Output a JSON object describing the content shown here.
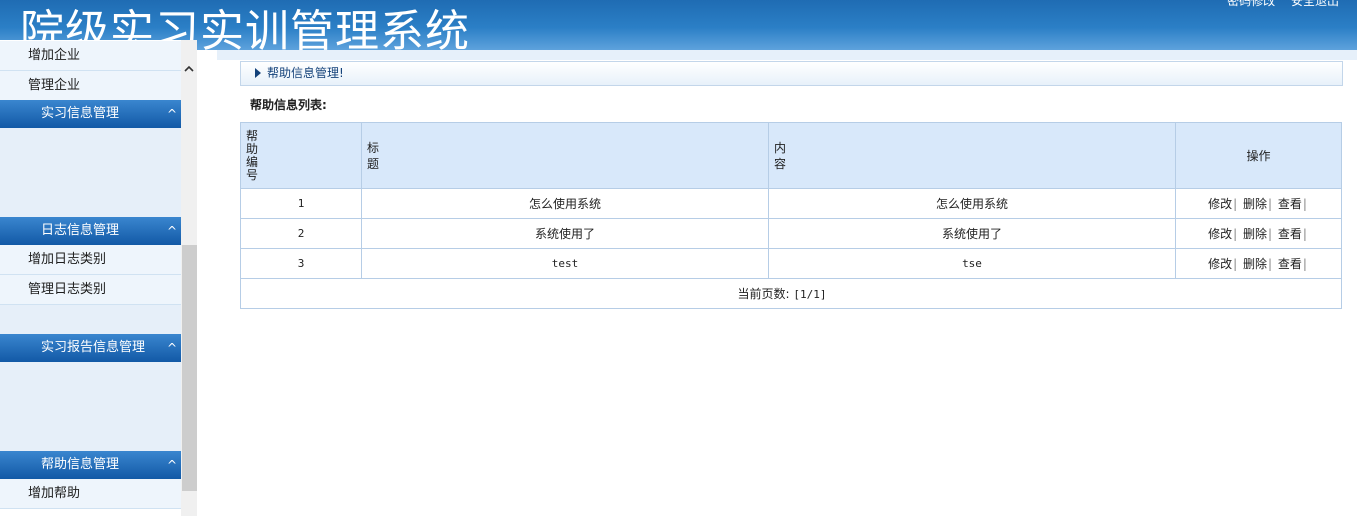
{
  "header": {
    "title": "院级实习实训管理系统",
    "links": [
      "密码修改",
      "安全退出"
    ]
  },
  "sidebar": {
    "top_items": [
      "增加企业",
      "管理企业"
    ],
    "groups": [
      {
        "label": "实习信息管理",
        "items": []
      },
      {
        "label": "日志信息管理",
        "items": [
          "增加日志类别",
          "管理日志类别"
        ]
      },
      {
        "label": "实习报告信息管理",
        "items": []
      },
      {
        "label": "帮助信息管理",
        "items": [
          "增加帮助"
        ]
      }
    ],
    "chevron": "^"
  },
  "main": {
    "breadcrumb": "帮助信息管理!",
    "list_title": "帮助信息列表:",
    "table": {
      "headers": [
        "帮助编号",
        "标题",
        "内容",
        "操作"
      ],
      "rows": [
        {
          "id": "1",
          "title": "怎么使用系统",
          "content": "怎么使用系统"
        },
        {
          "id": "2",
          "title": "系统使用了",
          "content": "系统使用了"
        },
        {
          "id": "3",
          "title": "test",
          "content": "tse"
        }
      ],
      "actions": [
        "修改",
        "删除",
        "查看"
      ],
      "action_sep": "|"
    },
    "pager": {
      "label": "当前页数:",
      "value": "[1/1]"
    }
  },
  "colors": {
    "header_blue": "#1f6cb3",
    "menu_header_blue": "#1259a6",
    "table_header_bg": "#d8e8fa",
    "border": "#b6cde6"
  }
}
